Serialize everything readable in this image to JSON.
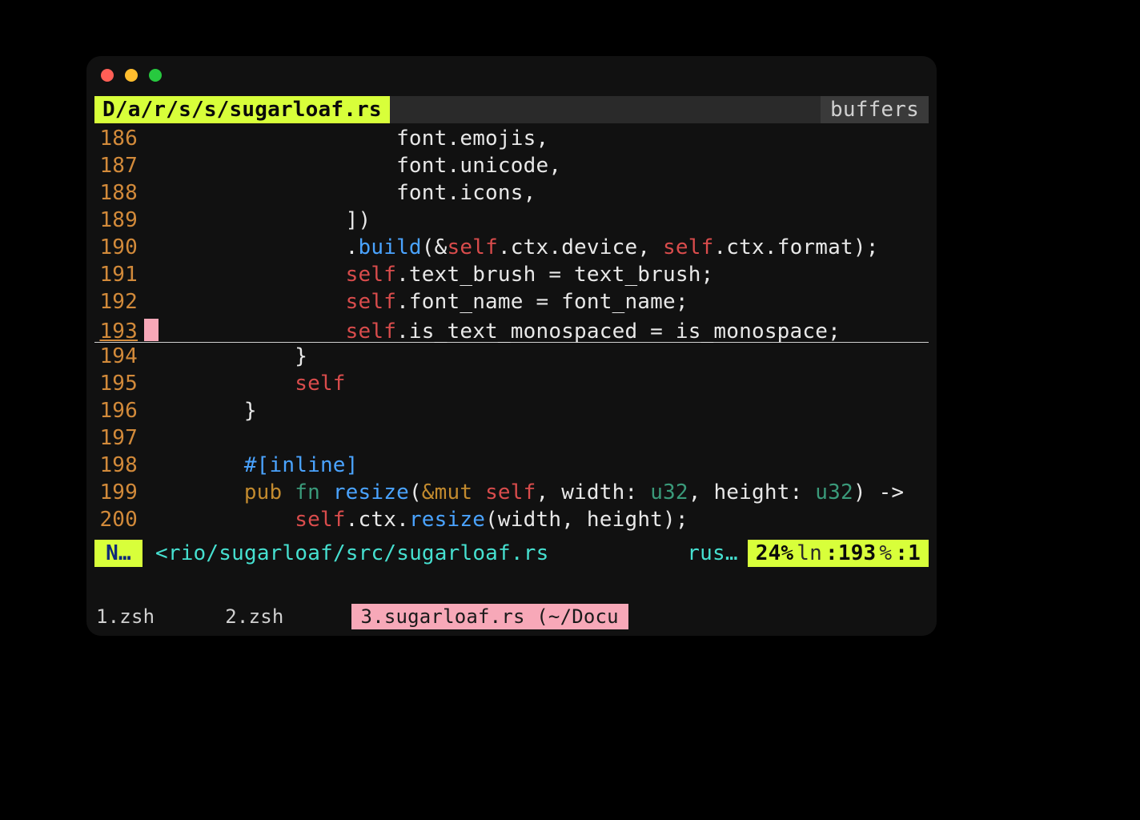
{
  "window": {
    "title_path": "D/a/r/s/s/sugarloaf.rs",
    "buffers_label": "buffers"
  },
  "colors": {
    "accent_lime": "#d8ff3a",
    "cursor_pink": "#f7a8b8",
    "self_red": "#d94c4c",
    "method_blue": "#4aa3ff",
    "teal": "#46e0d0",
    "orange": "#d28a3a"
  },
  "lines": [
    {
      "n": 186,
      "indent": "                    ",
      "tokens": [
        [
          "white",
          "font.emojis,"
        ]
      ]
    },
    {
      "n": 187,
      "indent": "                    ",
      "tokens": [
        [
          "white",
          "font.unicode,"
        ]
      ]
    },
    {
      "n": 188,
      "indent": "                    ",
      "tokens": [
        [
          "white",
          "font.icons,"
        ]
      ]
    },
    {
      "n": 189,
      "indent": "                ",
      "tokens": [
        [
          "white",
          "])"
        ]
      ]
    },
    {
      "n": 190,
      "indent": "                ",
      "tokens": [
        [
          "white",
          "."
        ],
        [
          "method",
          "build"
        ],
        [
          "white",
          "("
        ],
        [
          "amp",
          "&"
        ],
        [
          "self",
          "self"
        ],
        [
          "white",
          ".ctx.device, "
        ],
        [
          "self",
          "self"
        ],
        [
          "white",
          ".ctx.format);"
        ]
      ]
    },
    {
      "n": 191,
      "indent": "                ",
      "tokens": [
        [
          "self",
          "self"
        ],
        [
          "white",
          ".text_brush = text_brush;"
        ]
      ]
    },
    {
      "n": 192,
      "indent": "                ",
      "tokens": [
        [
          "self",
          "self"
        ],
        [
          "white",
          ".font_name = font_name;"
        ]
      ]
    },
    {
      "n": 193,
      "indent": "                ",
      "current": true,
      "tokens": [
        [
          "self",
          "self"
        ],
        [
          "white",
          ".is_text_monospaced = is_monospace;"
        ]
      ]
    },
    {
      "n": 194,
      "indent": "            ",
      "tokens": [
        [
          "white",
          "}"
        ]
      ]
    },
    {
      "n": 195,
      "indent": "            ",
      "tokens": [
        [
          "self",
          "self"
        ]
      ]
    },
    {
      "n": 196,
      "indent": "        ",
      "tokens": [
        [
          "white",
          "}"
        ]
      ]
    },
    {
      "n": 197,
      "indent": "",
      "tokens": []
    },
    {
      "n": 198,
      "indent": "        ",
      "tokens": [
        [
          "attr",
          "#[inline]"
        ]
      ]
    },
    {
      "n": 199,
      "indent": "        ",
      "tokens": [
        [
          "kw_pub",
          "pub "
        ],
        [
          "kw_fn",
          "fn "
        ],
        [
          "name",
          "resize"
        ],
        [
          "white",
          "("
        ],
        [
          "mut",
          "&mut "
        ],
        [
          "self",
          "self"
        ],
        [
          "white",
          ", width: "
        ],
        [
          "u32",
          "u32"
        ],
        [
          "white",
          ", height: "
        ],
        [
          "u32",
          "u32"
        ],
        [
          "white",
          ") ->"
        ]
      ]
    },
    {
      "n": 200,
      "indent": "            ",
      "tokens": [
        [
          "self",
          "self"
        ],
        [
          "white",
          ".ctx."
        ],
        [
          "method",
          "resize"
        ],
        [
          "white",
          "(width, height);"
        ]
      ]
    }
  ],
  "statusbar": {
    "mode": "N…",
    "path": "<rio/sugarloaf/src/sugarloaf.rs",
    "lang": "rus…",
    "percent": "24%",
    "ln_label": "ln",
    "ln_value": ":193",
    "col_label": "%",
    "col_value": ":1"
  },
  "tabs": [
    {
      "index": "1",
      "label": ".zsh",
      "active": false
    },
    {
      "index": "2",
      "label": ".zsh",
      "active": false
    },
    {
      "index": "3",
      "label": ".sugarloaf.rs (~/Docu",
      "active": true
    }
  ]
}
